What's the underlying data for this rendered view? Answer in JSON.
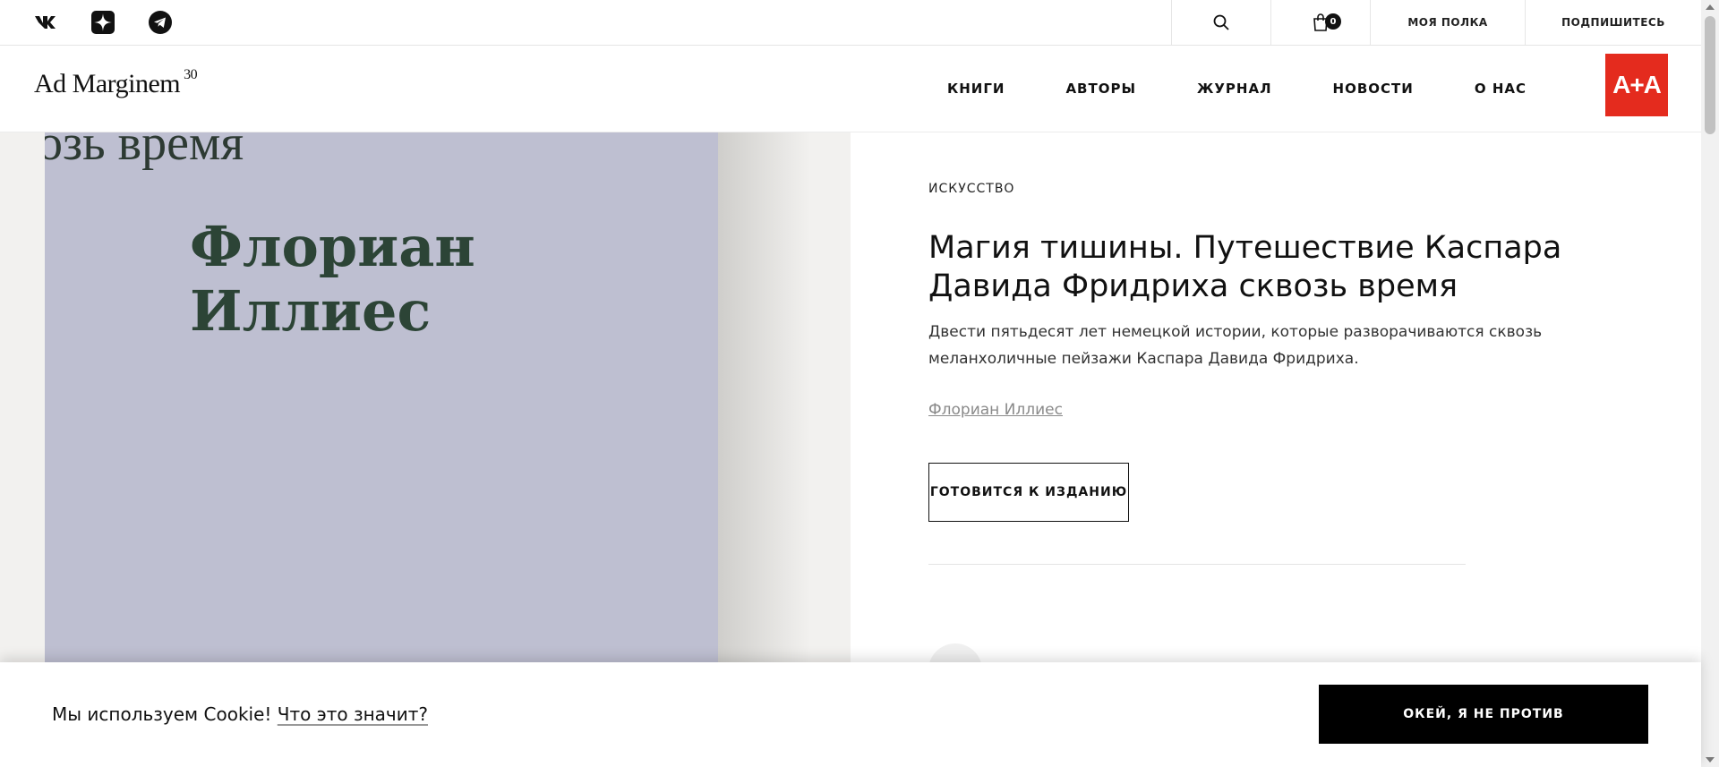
{
  "topbar": {
    "social": [
      {
        "icon": "vk-icon"
      },
      {
        "icon": "dzen-icon"
      },
      {
        "icon": "telegram-icon"
      }
    ],
    "search_icon": "search-icon",
    "cart_icon": "shopping-bag-icon",
    "cart_count": "0",
    "my_shelf": "МОЯ ПОЛКА",
    "subscribe": "ПОДПИШИТЕСЬ"
  },
  "header": {
    "logo_text": "Ad Marginem",
    "logo_sup": "30",
    "nav": [
      "КНИГИ",
      "АВТОРЫ",
      "ЖУРНАЛ",
      "НОВОСТИ",
      "О НАС"
    ],
    "partner_logo": "A+A",
    "partner_color": "#e42b1e"
  },
  "book": {
    "cover_top_text": "озь время",
    "cover_author_line1": "Флориан",
    "cover_author_line2": "Иллиес",
    "category": "ИСКУССТВО",
    "title": "Магия тишины. Путешествие Каспара Давида Фридриха сквозь время",
    "description": "Двести пятьдесят лет немецкой истории, которые разворачиваются сквозь меланхоличные пейзажи Каспара Давида Фридриха.",
    "author": "Флориан Иллиес",
    "status_button": "ГОТОВИТСЯ К ИЗДАНИЮ"
  },
  "cookie": {
    "text": "Мы используем Cookie!",
    "link": "Что это значит?",
    "accept": "ОКЕЙ, Я НЕ ПРОТИВ"
  }
}
